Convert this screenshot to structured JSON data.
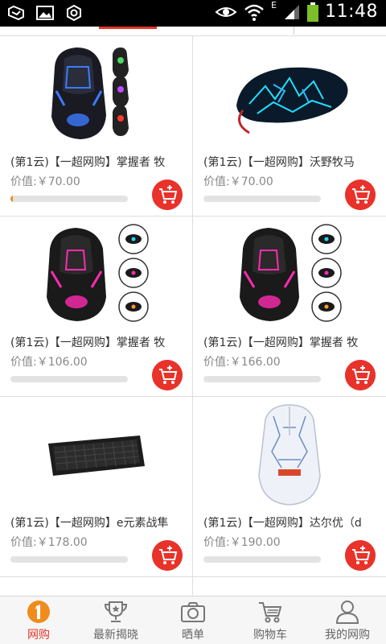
{
  "status_bar": {
    "time": "11:48",
    "network_letter": "E"
  },
  "products": [
    {
      "title": "(第1云)【一超网购】掌握者 牧",
      "price": "价值:￥70.00",
      "progress": 0.01,
      "image": "gaming-mouse-black-blue"
    },
    {
      "title": "(第1云)【一超网购】沃野牧马",
      "price": "价值:￥70.00",
      "progress": 0.0,
      "image": "gaming-mouse-cyan-crackle"
    },
    {
      "title": "(第1云)【一超网购】掌握者 牧",
      "price": "价值:￥106.00",
      "progress": 0.0,
      "image": "gaming-mouse-black-pink"
    },
    {
      "title": "(第1云)【一超网购】掌握者 牧",
      "price": "价值:￥166.00",
      "progress": 0.0,
      "image": "gaming-mouse-black-pink"
    },
    {
      "title": "(第1云)【一超网购】e元素战隼",
      "price": "价值:￥178.00",
      "progress": 0.0,
      "image": "mechanical-keyboard"
    },
    {
      "title": "(第1云)【一超网购】达尔优（d",
      "price": "价值:￥190.00",
      "progress": 0.0,
      "image": "gaming-mouse-white"
    }
  ],
  "bottom_nav": [
    {
      "label": "网购",
      "icon": "home-one-icon",
      "active": true
    },
    {
      "label": "最新揭晓",
      "icon": "trophy-icon",
      "active": false
    },
    {
      "label": "晒单",
      "icon": "camera-icon",
      "active": false
    },
    {
      "label": "购物车",
      "icon": "cart-icon",
      "active": false
    },
    {
      "label": "我的网购",
      "icon": "user-icon",
      "active": false
    }
  ],
  "colors": {
    "accent": "#e5342b",
    "progress_fill": "#f08c1c",
    "progress_track": "#e3e3e3"
  }
}
